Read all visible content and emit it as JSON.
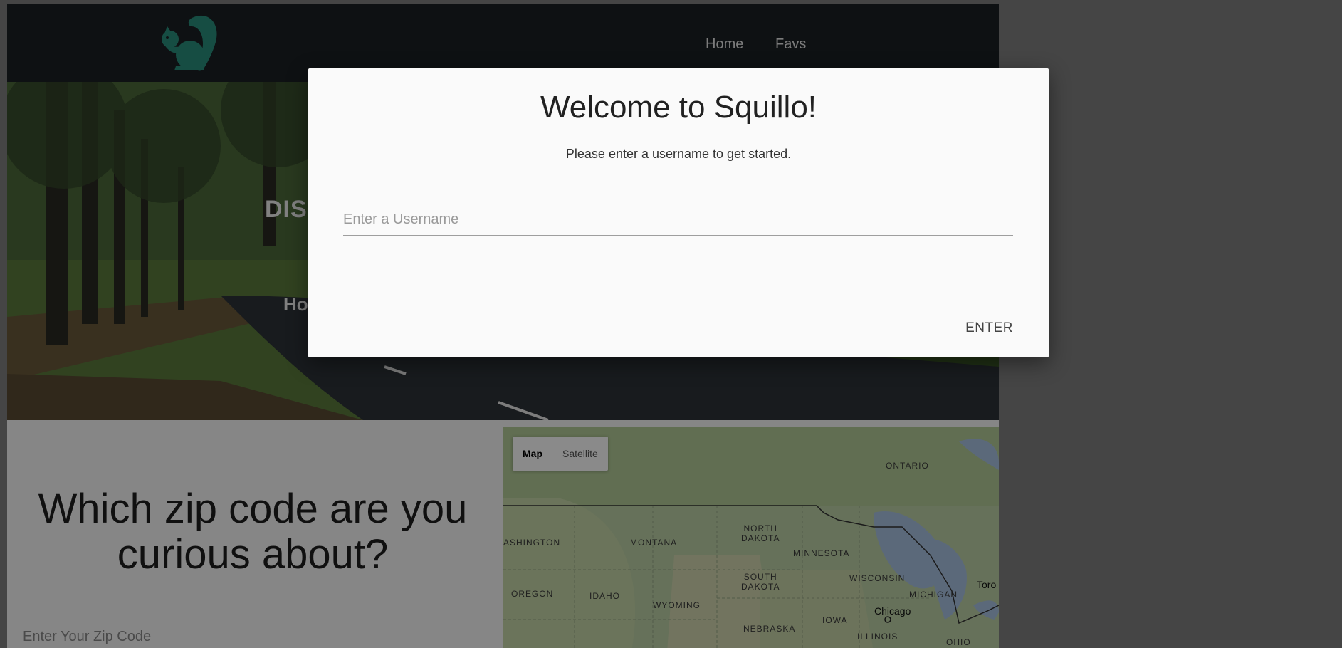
{
  "navbar": {
    "logo_icon": "squirrel-icon",
    "logo_color": "#2a8f7d",
    "links": [
      {
        "label": "Home"
      },
      {
        "label": "Favs"
      }
    ]
  },
  "hero": {
    "title": "DIS",
    "subtitle": "Ho"
  },
  "zip": {
    "heading": "Which zip code are you curious about?",
    "input_placeholder": "Enter Your Zip Code",
    "input_value": ""
  },
  "map": {
    "type_buttons": [
      {
        "label": "Map",
        "selected": true
      },
      {
        "label": "Satellite",
        "selected": false
      }
    ],
    "labels": {
      "ontario": "ONTARIO",
      "washington": "ASHINGTON",
      "montana": "MONTANA",
      "north_dakota": "NORTH\nDAKOTA",
      "minnesota": "MINNESOTA",
      "south_dakota": "SOUTH\nDAKOTA",
      "wisconsin": "WISCONSIN",
      "oregon": "OREGON",
      "idaho": "IDAHO",
      "wyoming": "WYOMING",
      "michigan": "MICHIGAN",
      "iowa": "IOWA",
      "nebraska": "NEBRASKA",
      "illinois": "ILLINOIS",
      "ohio": "OHIO",
      "chicago": "Chicago",
      "toronto": "Toro"
    }
  },
  "modal": {
    "title": "Welcome to Squillo!",
    "subtitle": "Please enter a username to get started.",
    "input_placeholder": "Enter a Username",
    "input_value": "",
    "enter_label": "ENTER"
  }
}
